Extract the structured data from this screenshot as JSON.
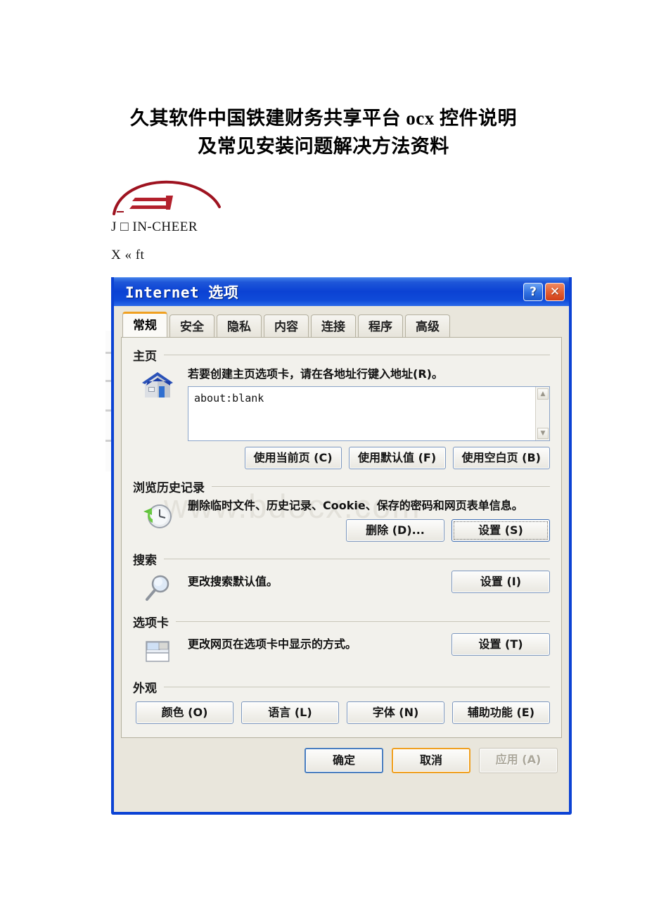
{
  "document": {
    "title_line1": "久其软件中国铁建财务共享平台 ocx 控件说明",
    "title_line2": "及常见安装问题解决方法资料",
    "logo_text": "J □ IN-CHEER",
    "logo_sub": "X « ft",
    "watermark": "www.bdocx.com"
  },
  "dialog": {
    "title": "Internet 选项",
    "help_button": "?",
    "close_button": "✕",
    "tabs": [
      {
        "label": "常规",
        "active": true
      },
      {
        "label": "安全",
        "active": false
      },
      {
        "label": "隐私",
        "active": false
      },
      {
        "label": "内容",
        "active": false
      },
      {
        "label": "连接",
        "active": false
      },
      {
        "label": "程序",
        "active": false
      },
      {
        "label": "高级",
        "active": false
      }
    ],
    "sections": {
      "homepage": {
        "label": "主页",
        "description": "若要创建主页选项卡，请在各地址行键入地址(R)。",
        "url_value": "about:blank",
        "buttons": {
          "use_current": "使用当前页 (C)",
          "use_default": "使用默认值 (F)",
          "use_blank": "使用空白页 (B)"
        }
      },
      "history": {
        "label": "浏览历史记录",
        "description": "删除临时文件、历史记录、Cookie、保存的密码和网页表单信息。",
        "buttons": {
          "delete": "删除 (D)...",
          "settings": "设置 (S)"
        }
      },
      "search": {
        "label": "搜索",
        "description": "更改搜索默认值。",
        "buttons": {
          "settings": "设置 (I)"
        }
      },
      "tabs_section": {
        "label": "选项卡",
        "description": "更改网页在选项卡中显示的方式。",
        "buttons": {
          "settings": "设置 (T)"
        }
      },
      "appearance": {
        "label": "外观",
        "buttons": {
          "colors": "颜色 (O)",
          "languages": "语言 (L)",
          "fonts": "字体 (N)",
          "accessibility": "辅助功能 (E)"
        }
      }
    },
    "actions": {
      "ok": "确定",
      "cancel": "取消",
      "apply": "应用 (A)"
    }
  },
  "colors": {
    "titlebar_blue": "#0b42d4",
    "active_tab_accent": "#f0a020",
    "logo_red": "#a51320",
    "close_red": "#e45f32",
    "panel_bg": "#f2f1ec",
    "dialog_bg": "#e9e6dc"
  }
}
